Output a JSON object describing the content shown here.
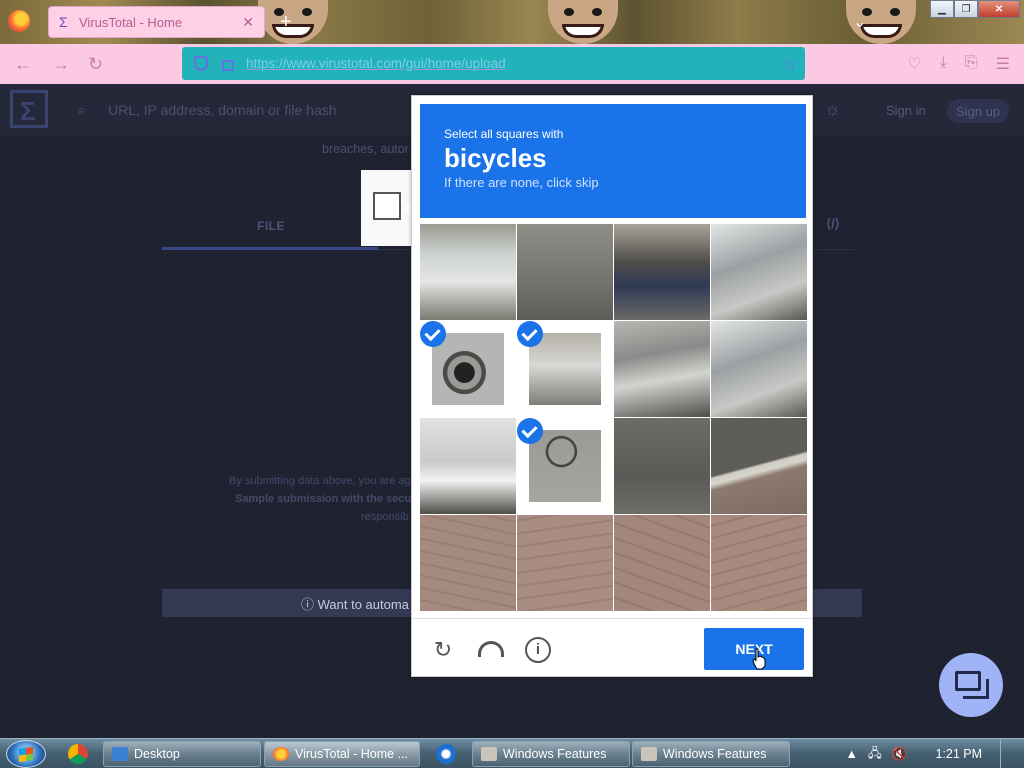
{
  "browser": {
    "tab_title": "VirusTotal - Home",
    "tab_close": "✕",
    "new_tab": "+",
    "tabs_menu": "⌄",
    "url": "https://www.virustotal.com/gui/home/upload",
    "window_controls": {
      "minimize": "▁",
      "maximize": "❐",
      "close": "✕"
    },
    "nav_icons": {
      "back": "←",
      "forward": "→",
      "reload": "↻",
      "bookmark": "☆",
      "pocket": "♡",
      "downloads": "⤓",
      "extensions": "⎘",
      "menu": "☰"
    }
  },
  "page": {
    "search_placeholder": "URL, IP address, domain or file hash",
    "signin": "Sign in",
    "signup": "Sign up",
    "breaches_text": "breaches, autor",
    "tab_file": "FILE",
    "submit_line1": "By submitting data above, you are ag",
    "submit_line2": "Sample submission with the secu",
    "submit_line3": "responsib",
    "banner_text": "ⓘ Want to automa",
    "code_icon": "⟨/⟩",
    "sun_icon": "☼",
    "search_icon": "⌕"
  },
  "captcha": {
    "instruction": "Select all squares with",
    "target": "bicycles",
    "hint": "If there are none, click skip",
    "next_label": "NEXT",
    "reload_icon": "↻",
    "info_icon": "i",
    "tiles": [
      {
        "img": "sky-car",
        "selected": false
      },
      {
        "img": "street",
        "selected": false
      },
      {
        "img": "man",
        "selected": false
      },
      {
        "img": "car-door",
        "selected": false
      },
      {
        "img": "wheel",
        "selected": true
      },
      {
        "img": "bike1",
        "selected": true
      },
      {
        "img": "car-side",
        "selected": false
      },
      {
        "img": "car-door",
        "selected": false
      },
      {
        "img": "car-white",
        "selected": false
      },
      {
        "img": "bike3",
        "selected": true
      },
      {
        "img": "road",
        "selected": false
      },
      {
        "img": "curb",
        "selected": false
      },
      {
        "img": "pave1",
        "selected": false
      },
      {
        "img": "pave2",
        "selected": false
      },
      {
        "img": "pave3",
        "selected": false
      },
      {
        "img": "pave4",
        "selected": false
      }
    ]
  },
  "taskbar": {
    "items": [
      {
        "label": "Desktop",
        "active": false
      },
      {
        "label": "VirusTotal - Home ...",
        "active": true
      },
      {
        "label": "Windows Features",
        "active": false
      },
      {
        "label": "Windows Features",
        "active": false
      }
    ],
    "clock": "1:21 PM"
  },
  "colors": {
    "accent": "#1a73e8",
    "page_bg": "#1f2231",
    "tab_bg": "#fdd0e6",
    "url_bg": "#21b2ba"
  }
}
